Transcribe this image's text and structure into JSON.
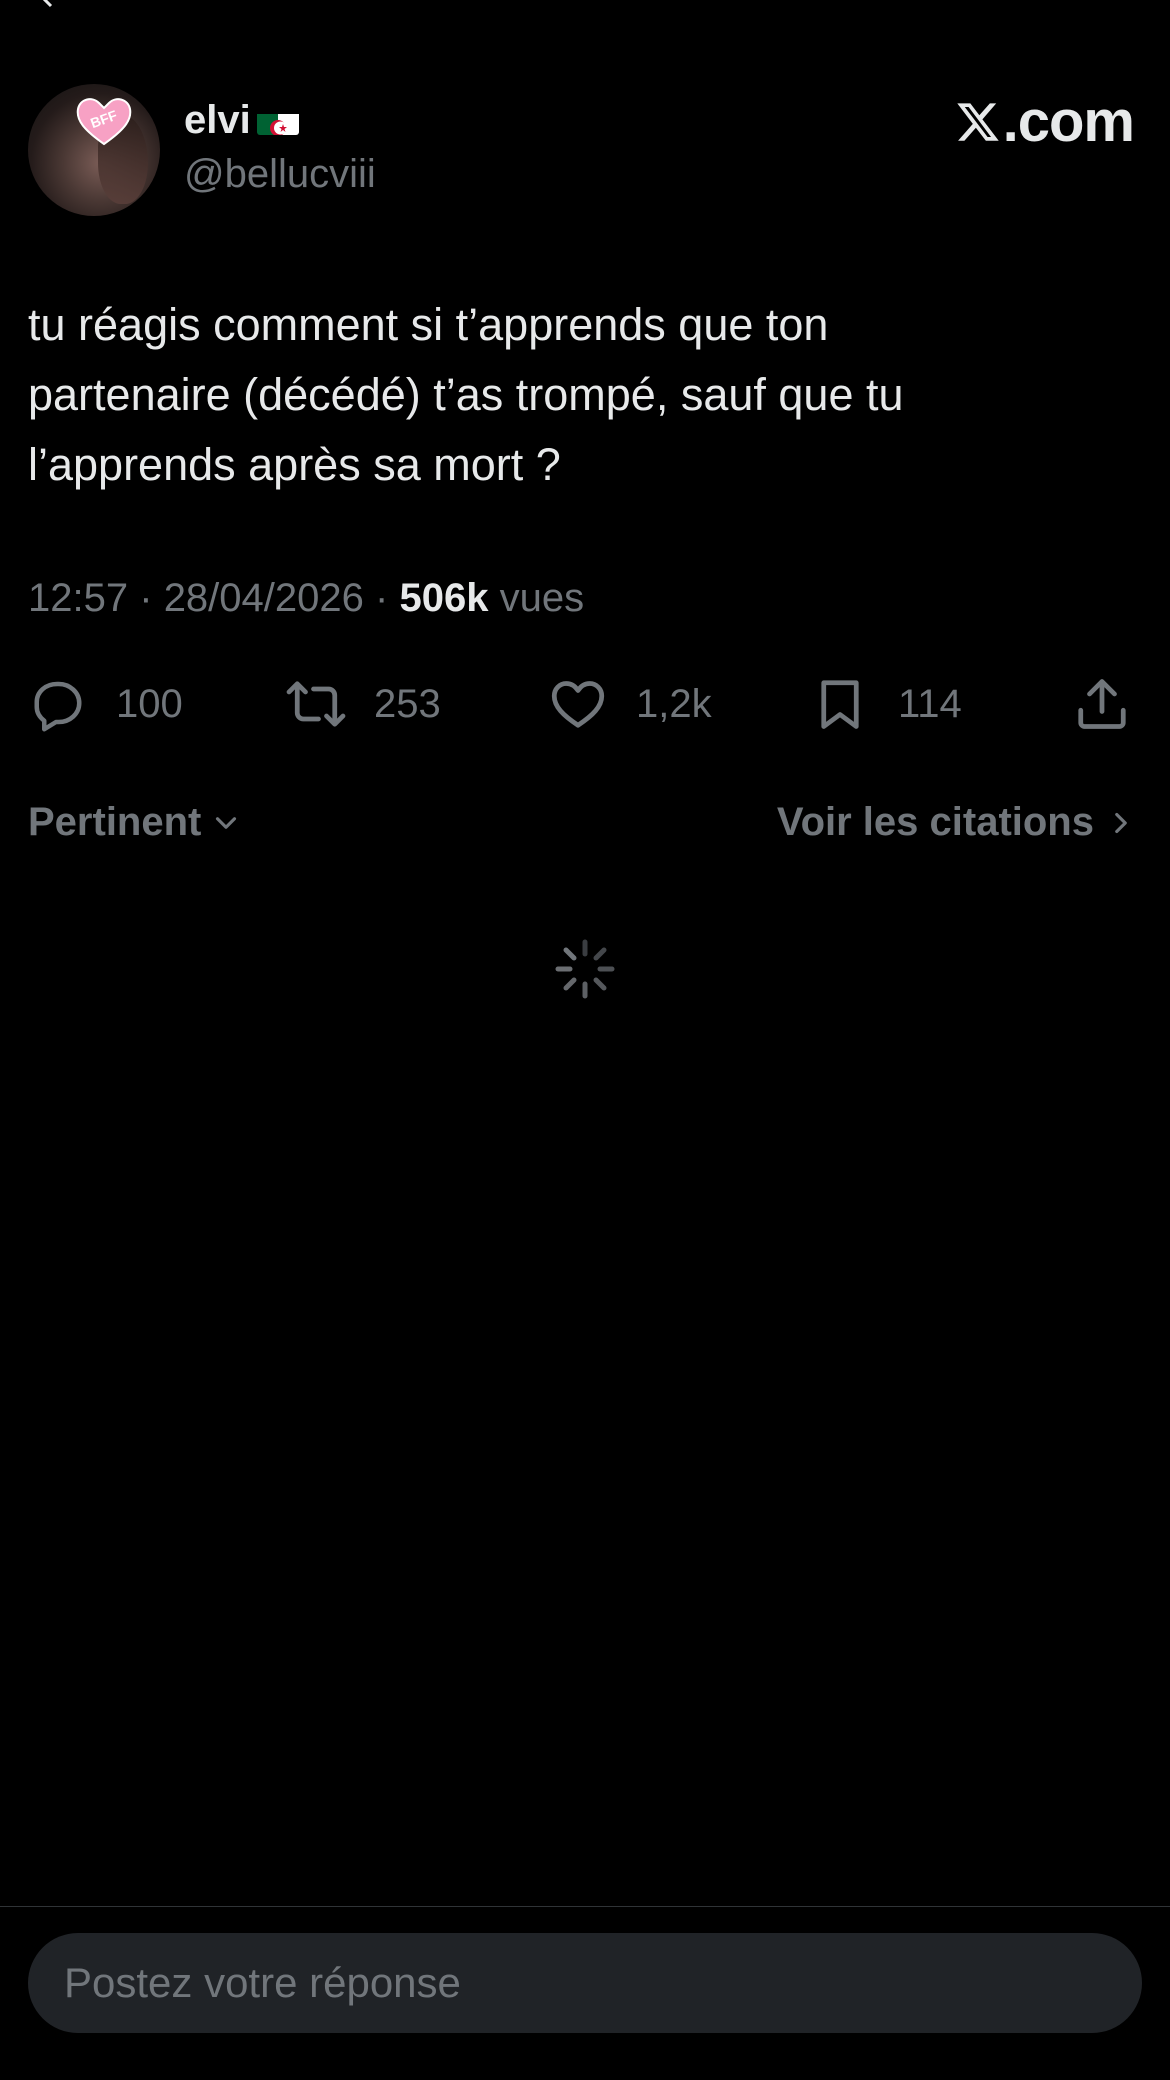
{
  "author": {
    "display_name": "elvi",
    "handle": "@bellucviii",
    "flag_icon": "algeria-flag-icon",
    "avatar_sticker_text": "BFF"
  },
  "brand": {
    "label": "X.com"
  },
  "tweet": {
    "line1": "tu réagis comment si t’apprends que ton",
    "line2": "partenaire (décédé) t’as trompé, sauf que tu",
    "line3": "l’apprends après sa mort ?",
    "time": "12:57",
    "date": "28/04/2026",
    "separator": "·",
    "views_count": "506k",
    "views_label": "vues"
  },
  "actions": {
    "replies": "100",
    "reposts": "253",
    "likes": "1,2k",
    "bookmarks": "114"
  },
  "sort": {
    "left_label": "Pertinent",
    "right_label": "Voir les citations"
  },
  "reply": {
    "placeholder": "Postez votre réponse"
  },
  "colors": {
    "background": "#000000",
    "text": "#e7e9ea",
    "muted": "#71767b",
    "input_bg": "#202327"
  }
}
